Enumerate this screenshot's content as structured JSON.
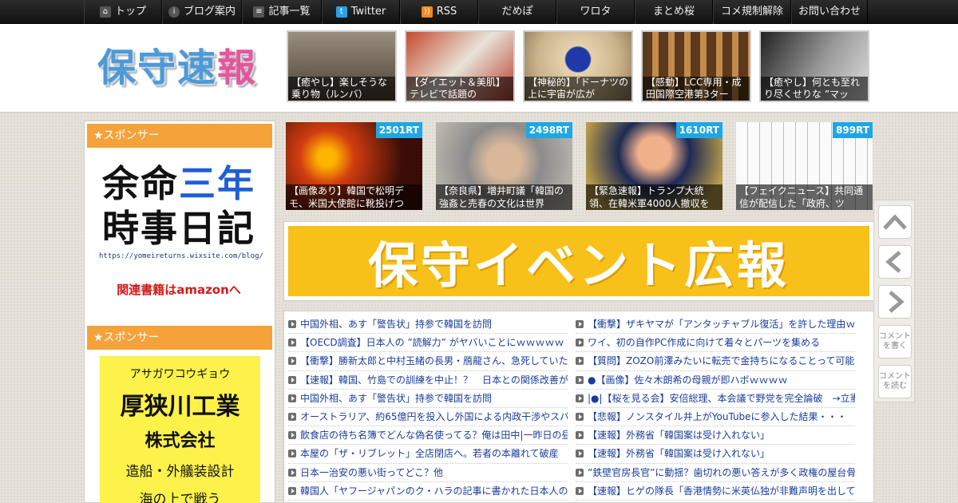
{
  "nav": {
    "items": [
      {
        "label": "トップ",
        "icon": "home-icon"
      },
      {
        "label": "ブログ案内",
        "icon": "info-icon"
      },
      {
        "label": "記事一覧",
        "icon": "list-icon"
      },
      {
        "label": "Twitter",
        "icon": "twitter-icon"
      },
      {
        "label": "RSS",
        "icon": "rss-icon"
      },
      {
        "label": "だめぽ",
        "icon": ""
      },
      {
        "label": "ワロタ",
        "icon": ""
      },
      {
        "label": "まとめ桜",
        "icon": ""
      },
      {
        "label": "コメ規制解除",
        "icon": ""
      },
      {
        "label": "お問い合わせ",
        "icon": ""
      }
    ]
  },
  "header": {
    "logo_part1": "保守",
    "logo_part2": "速",
    "logo_part3": "報",
    "featured": [
      "【癒やし】楽しそうな乗り物（ルンバ）",
      "【ダイエット＆美肌】テレビで話題の",
      "【神秘的】「ドーナツの上に宇宙が広が",
      "【感動】LCC専用・成田国際空港第3ター",
      "【癒やし】何とも至れり尽くせりな ”マッ"
    ]
  },
  "sidebar": {
    "sponsor_label": "★スポンサー",
    "ad1": {
      "line1a": "余命",
      "line1b": "三年",
      "line2": "時事日記",
      "url": "https://yomeireturns.wixsite.com/blog/",
      "amazon": "関連書籍はamazonへ"
    },
    "ad2": {
      "kana": "アサガワコウギョウ",
      "name": "厚狭川工業",
      "company": "株式会社",
      "service": "造船・外艤装設計",
      "more": "海の上で戦う"
    }
  },
  "ranking": [
    {
      "rt": "2501RT",
      "caption": "【画像あり】韓国で松明デモ、米国大使館に靴投げつ"
    },
    {
      "rt": "2498RT",
      "caption": "【奈良県】増井町議「韓国の強姦と売春の文化は世界"
    },
    {
      "rt": "1610RT",
      "caption": "【緊急速報】トランプ大統領、在韓米軍4000人撤収を"
    },
    {
      "rt": "899RT",
      "caption": "【フェイクニュース】共同通信が配信した「政府、ツ"
    }
  ],
  "banner": {
    "text": "保守イベント広報"
  },
  "links_left": [
    "中国外相、あす「警告状」持参で韓国を訪問",
    "【OECD調査】日本人の ”読解力” がヤバいことにｗｗｗｗｗ",
    "【衝撃】勝新太郎と中村玉緒の長男・鴈龍さん、急死していた",
    "【速報】韓国、竹島での訓練を中止！？　日本との関係改善が",
    "中国外相、あす「警告状」持参で韓国を訪問",
    "オーストラリア、約65億円を投入し外国による内政干渉やスパ",
    "飲食店の待ち名簿でどんな偽名使ってる？俺は田中|一昨日の昼",
    "本屋の「ザ・リブレット」全店閉店へ。若者の本離れて破産",
    "日本一治安の悪い街ってどこ？他",
    "韓国人「ヤフージャパンのク・ハラの記事に書かれた日本人の"
  ],
  "links_right": [
    "【衝撃】ザキヤマが「アンタッチャブル復活」を許した理由ｗ",
    "ワイ、初の自作PC作成に向けて着々とパーツを集める",
    "【質問】ZOZO前澤みたいに転売で金持ちになることって可能か",
    "●【画像】佐々木朗希の母親が即ハボｗｗｗｗ",
    "|●|【桜を見る会】安倍総理、本会議で野党を完全論破　→立憲",
    "【悲報】ノンスタイル井上がYouTubeに参入した結果・・・",
    "【速報】外務省「韓国案は受け入れない」",
    "【速報】外務省「韓国案は受け入れない」",
    "”鉄壁官房長官”に動揺？歯切れの悪い答えが多く政権の屋台骨",
    "【速報】ヒゲの隊長「香港情勢に米英仏独が非難声明を出して"
  ],
  "side_buttons": {
    "comment_write": "コメントを書く",
    "comment_read": "コメントを読む"
  }
}
